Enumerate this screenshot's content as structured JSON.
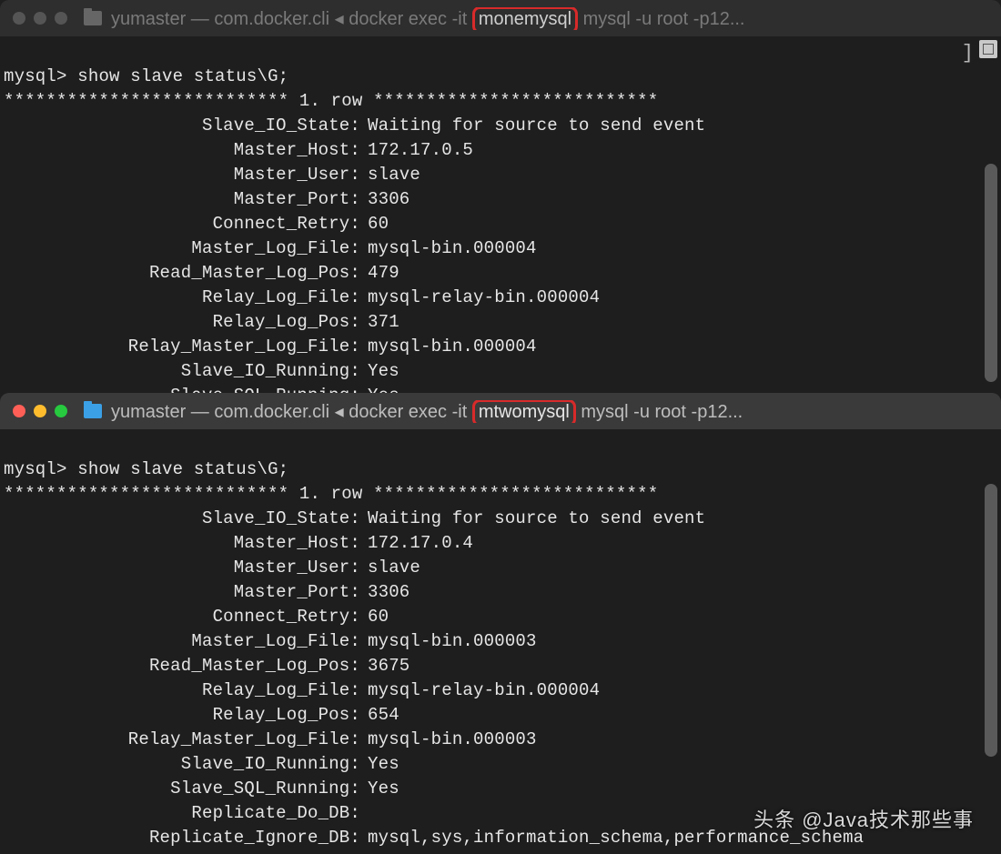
{
  "top": {
    "title_prefix": "yumaster — com.docker.cli ◂ docker exec -it ",
    "title_highlight": "monemysql",
    "title_suffix": " mysql -u root -p12...",
    "prompt": "mysql>",
    "command": "show slave status\\G;",
    "stars_row": "*************************** 1. row ***************************",
    "bracket": "]",
    "fields": [
      {
        "label": "Slave_IO_State:",
        "value": "Waiting for source to send event"
      },
      {
        "label": "Master_Host:",
        "value": "172.17.0.5"
      },
      {
        "label": "Master_User:",
        "value": "slave"
      },
      {
        "label": "Master_Port:",
        "value": "3306"
      },
      {
        "label": "Connect_Retry:",
        "value": "60"
      },
      {
        "label": "Master_Log_File:",
        "value": "mysql-bin.000004"
      },
      {
        "label": "Read_Master_Log_Pos:",
        "value": "479"
      },
      {
        "label": "Relay_Log_File:",
        "value": "mysql-relay-bin.000004"
      },
      {
        "label": "Relay_Log_Pos:",
        "value": "371"
      },
      {
        "label": "Relay_Master_Log_File:",
        "value": "mysql-bin.000004"
      },
      {
        "label": "Slave_IO_Running:",
        "value": "Yes"
      },
      {
        "label": "Slave_SQL_Running:",
        "value": "Yes"
      }
    ]
  },
  "bottom": {
    "title_prefix": "yumaster — com.docker.cli ◂ docker exec -it ",
    "title_highlight": "mtwomysql",
    "title_suffix": " mysql -u root -p12...",
    "prompt": "mysql>",
    "command": "show slave status\\G;",
    "stars_row": "*************************** 1. row ***************************",
    "fields": [
      {
        "label": "Slave_IO_State:",
        "value": "Waiting for source to send event"
      },
      {
        "label": "Master_Host:",
        "value": "172.17.0.4"
      },
      {
        "label": "Master_User:",
        "value": "slave"
      },
      {
        "label": "Master_Port:",
        "value": "3306"
      },
      {
        "label": "Connect_Retry:",
        "value": "60"
      },
      {
        "label": "Master_Log_File:",
        "value": "mysql-bin.000003"
      },
      {
        "label": "Read_Master_Log_Pos:",
        "value": "3675"
      },
      {
        "label": "Relay_Log_File:",
        "value": "mysql-relay-bin.000004"
      },
      {
        "label": "Relay_Log_Pos:",
        "value": "654"
      },
      {
        "label": "Relay_Master_Log_File:",
        "value": "mysql-bin.000003"
      },
      {
        "label": "Slave_IO_Running:",
        "value": "Yes"
      },
      {
        "label": "Slave_SQL_Running:",
        "value": "Yes"
      },
      {
        "label": "Replicate_Do_DB:",
        "value": ""
      },
      {
        "label": "Replicate_Ignore_DB:",
        "value": "mysql,sys,information_schema,performance_schema"
      }
    ]
  },
  "watermark": "头条 @Java技术那些事"
}
